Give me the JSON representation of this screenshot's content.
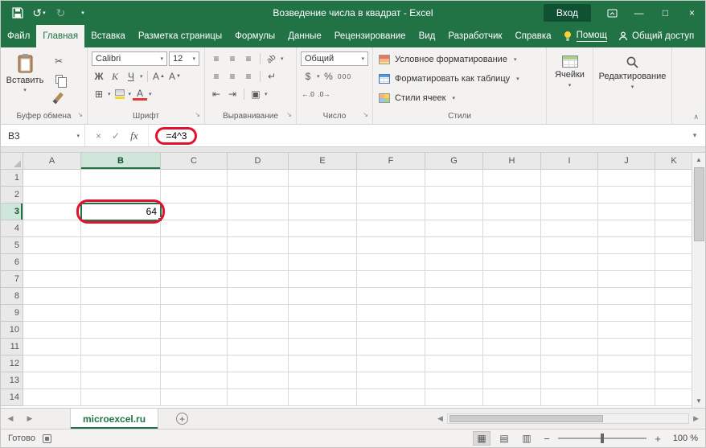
{
  "colors": {
    "excel_green": "#217346",
    "annotation_red": "#e3112e"
  },
  "title_bar": {
    "title": "Возведение числа в квадрат - Excel",
    "sign_in_label": "Вход"
  },
  "tab_bar": {
    "file_tab": "Файл",
    "tabs": [
      {
        "label": "Главная",
        "active": true
      },
      {
        "label": "Вставка"
      },
      {
        "label": "Разметка страницы"
      },
      {
        "label": "Формулы"
      },
      {
        "label": "Данные"
      },
      {
        "label": "Рецензирование"
      },
      {
        "label": "Вид"
      },
      {
        "label": "Разработчик"
      },
      {
        "label": "Справка"
      }
    ],
    "assistant_label": "Помощ",
    "share_label": "Общий доступ"
  },
  "ribbon": {
    "clipboard": {
      "group_label": "Буфер обмена",
      "paste_label": "Вставить"
    },
    "font": {
      "group_label": "Шрифт",
      "font_name": "Calibri",
      "font_size": "12",
      "bold": "Ж",
      "italic": "К",
      "underline": "Ч"
    },
    "alignment": {
      "group_label": "Выравнивание"
    },
    "number": {
      "group_label": "Число",
      "format": "Общий",
      "percent": "%",
      "thousands": "000"
    },
    "styles": {
      "group_label": "Стили",
      "conditional_label": "Условное форматирование",
      "format_table_label": "Форматировать как таблицу",
      "cell_styles_label": "Стили ячеек"
    },
    "cells": {
      "button_label": "Ячейки"
    },
    "editing": {
      "button_label": "Редактирование"
    }
  },
  "formula_bar": {
    "name_box": "B3",
    "fx_label": "fx",
    "formula": "=4^3"
  },
  "grid": {
    "columns": [
      "A",
      "B",
      "C",
      "D",
      "E",
      "F",
      "G",
      "H",
      "I",
      "J",
      "K"
    ],
    "row_count": 14,
    "selected": {
      "col": "B",
      "row": 3
    },
    "cells": [
      {
        "ref": "B3",
        "value": "64"
      }
    ]
  },
  "sheet_bar": {
    "tabs": [
      {
        "label": "microexcel.ru",
        "active": true
      }
    ]
  },
  "status_bar": {
    "mode": "Готово",
    "zoom_label": "100 %"
  }
}
